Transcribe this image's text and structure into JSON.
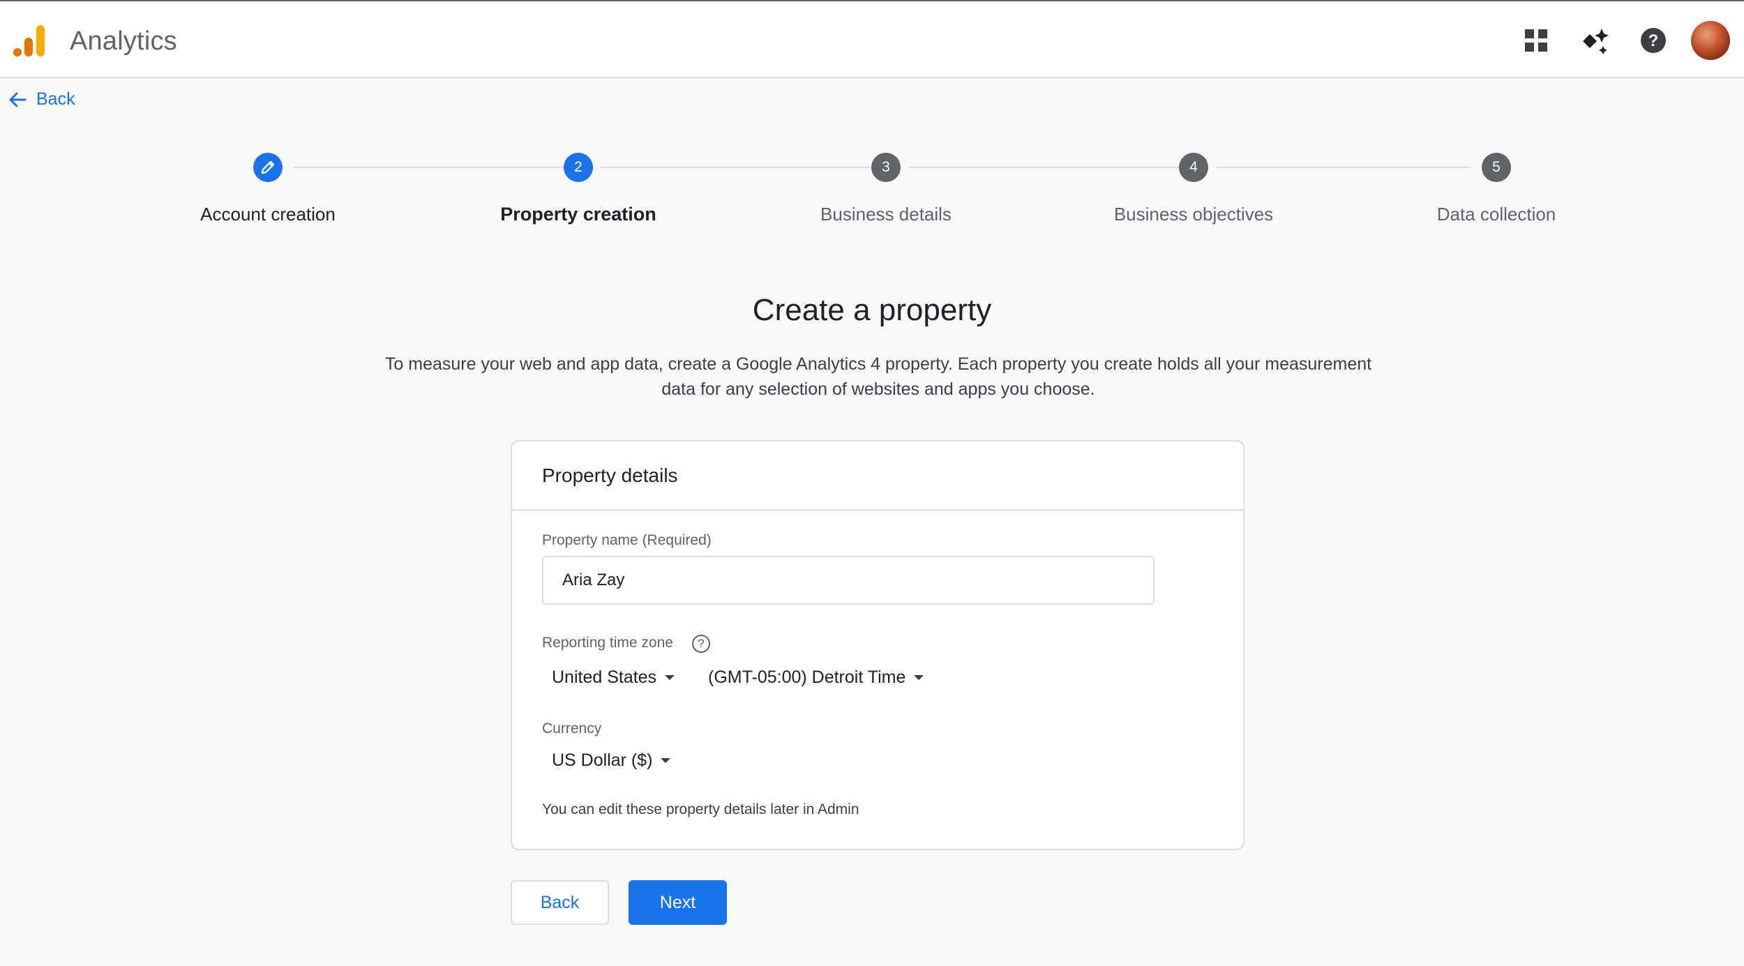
{
  "app": {
    "title": "Analytics"
  },
  "header_icons": [
    "apps-grid-icon",
    "sparkle-icon",
    "help-icon",
    "user-avatar"
  ],
  "nav": {
    "back_label": "Back"
  },
  "stepper": {
    "steps": [
      {
        "label": "Account creation",
        "number": "",
        "state": "completed"
      },
      {
        "label": "Property creation",
        "number": "2",
        "state": "active"
      },
      {
        "label": "Business details",
        "number": "3",
        "state": "pending"
      },
      {
        "label": "Business objectives",
        "number": "4",
        "state": "pending"
      },
      {
        "label": "Data collection",
        "number": "5",
        "state": "pending"
      }
    ]
  },
  "page": {
    "title": "Create a property",
    "subtitle": "To measure your web and app data, create a Google Analytics 4 property. Each property you create holds all your measurement data for any selection of websites and apps you choose."
  },
  "form": {
    "card_title": "Property details",
    "property_name_label": "Property name (Required)",
    "property_name_value": "Aria Zay",
    "timezone_label": "Reporting time zone",
    "country_value": "United States",
    "timezone_value": "(GMT-05:00) Detroit Time",
    "currency_label": "Currency",
    "currency_value": "US Dollar ($)",
    "note": "You can edit these property details later in Admin"
  },
  "actions": {
    "back_label": "Back",
    "next_label": "Next"
  },
  "colors": {
    "primary": "#1a73e8",
    "pending_step": "#5f6368",
    "logo_orange": "#f9ab00",
    "logo_dark_orange": "#e37400"
  }
}
